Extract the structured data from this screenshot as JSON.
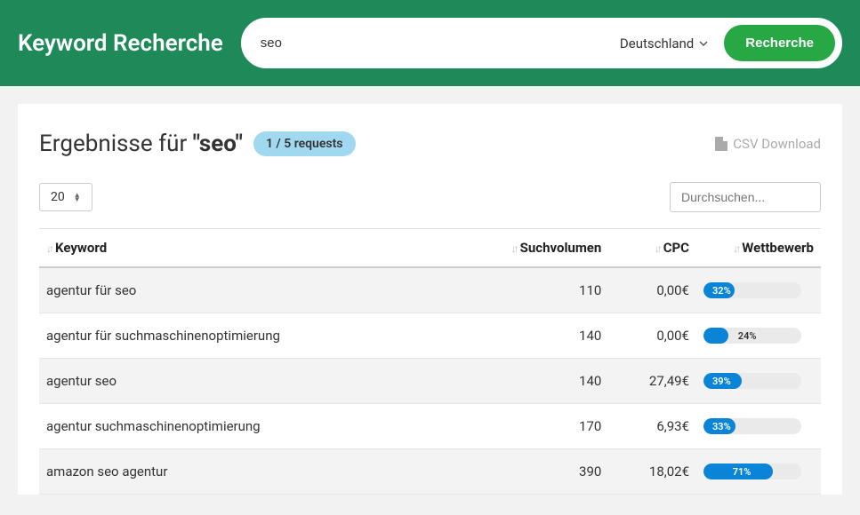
{
  "header": {
    "title": "Keyword Recherche",
    "search_value": "seo",
    "country": "Deutschland",
    "search_button": "Recherche"
  },
  "results": {
    "title_prefix": "Ergebnisse für ",
    "title_keyword": "\"seo\"",
    "badge": "1 / 5 requests",
    "csv_label": "CSV Download",
    "page_size": "20",
    "filter_placeholder": "Durchsuchen..."
  },
  "table": {
    "headers": {
      "keyword": "Keyword",
      "volume": "Suchvolumen",
      "cpc": "CPC",
      "competition": "Wettbewerb"
    },
    "rows": [
      {
        "keyword": "agentur für seo",
        "volume": "110",
        "cpc": "0,00€",
        "comp_pct": 32,
        "comp_label": "32%",
        "label_inside": true
      },
      {
        "keyword": "agentur für suchmaschinenoptimierung",
        "volume": "140",
        "cpc": "0,00€",
        "comp_pct": 24,
        "comp_label": "24%",
        "label_inside": false
      },
      {
        "keyword": "agentur seo",
        "volume": "140",
        "cpc": "27,49€",
        "comp_pct": 39,
        "comp_label": "39%",
        "label_inside": true
      },
      {
        "keyword": "agentur suchmaschinenoptimierung",
        "volume": "170",
        "cpc": "6,93€",
        "comp_pct": 33,
        "comp_label": "33%",
        "label_inside": true
      },
      {
        "keyword": "amazon seo agentur",
        "volume": "390",
        "cpc": "18,02€",
        "comp_pct": 71,
        "comp_label": "71%",
        "label_inside": true
      }
    ]
  }
}
